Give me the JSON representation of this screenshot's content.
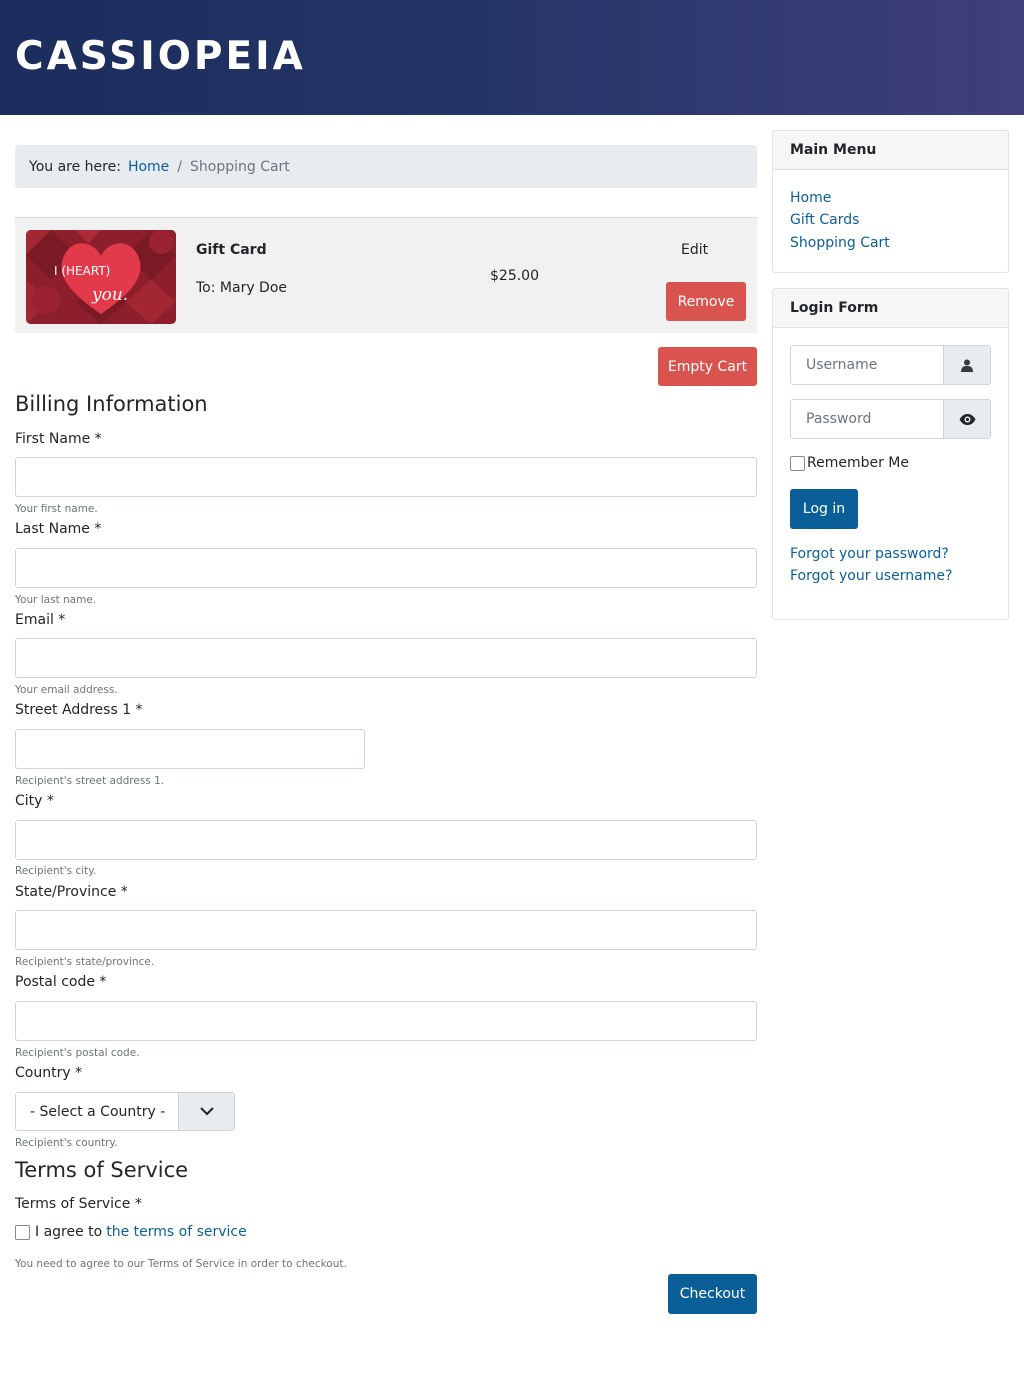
{
  "header": {
    "brand": "CASSIOPEIA"
  },
  "breadcrumb": {
    "prefix": "You are here:",
    "home": "Home",
    "separator": "/",
    "current": "Shopping Cart"
  },
  "cart": {
    "item": {
      "image_text_line1": "I (HEART)",
      "image_text_line2": "you.",
      "name": "Gift Card",
      "recipient": "To: Mary Doe",
      "price": "$25.00",
      "edit_label": "Edit",
      "remove_label": "Remove"
    },
    "empty_cart_label": "Empty Cart"
  },
  "billing": {
    "heading": "Billing Information",
    "fields": [
      {
        "label": "First Name *",
        "help": "Your first name.",
        "value": ""
      },
      {
        "label": "Last Name *",
        "help": "Your last name.",
        "value": ""
      },
      {
        "label": "Email *",
        "help": "Your email address.",
        "value": ""
      },
      {
        "label": "Street Address 1 *",
        "help": "Recipient's street address 1.",
        "value": ""
      },
      {
        "label": "City *",
        "help": "Recipient's city.",
        "value": ""
      },
      {
        "label": "State/Province *",
        "help": "Recipient's state/province.",
        "value": ""
      },
      {
        "label": "Postal code *",
        "help": "Recipient's postal code.",
        "value": ""
      }
    ],
    "country": {
      "label": "Country *",
      "selected": "- Select a Country -",
      "help": "Recipient's country."
    }
  },
  "terms": {
    "heading": "Terms of Service",
    "label": "Terms of Service *",
    "agree_prefix": "I agree to",
    "agree_link": "the terms of service",
    "help": "You need to agree to our Terms of Service in order to checkout.",
    "checkout_label": "Checkout"
  },
  "sidebar": {
    "main_menu": {
      "title": "Main Menu",
      "items": [
        "Home",
        "Gift Cards",
        "Shopping Cart"
      ]
    },
    "login": {
      "title": "Login Form",
      "username_placeholder": "Username",
      "password_placeholder": "Password",
      "remember_label": "Remember Me",
      "login_label": "Log in",
      "forgot_password": "Forgot your password?",
      "forgot_username": "Forgot your username?"
    }
  },
  "colors": {
    "link": "#0b5f99",
    "primary_button": "#0b5f99",
    "danger_button": "#d9534f",
    "header_gradient_start": "#1b2d5c",
    "header_gradient_end": "#3f3f7c"
  }
}
